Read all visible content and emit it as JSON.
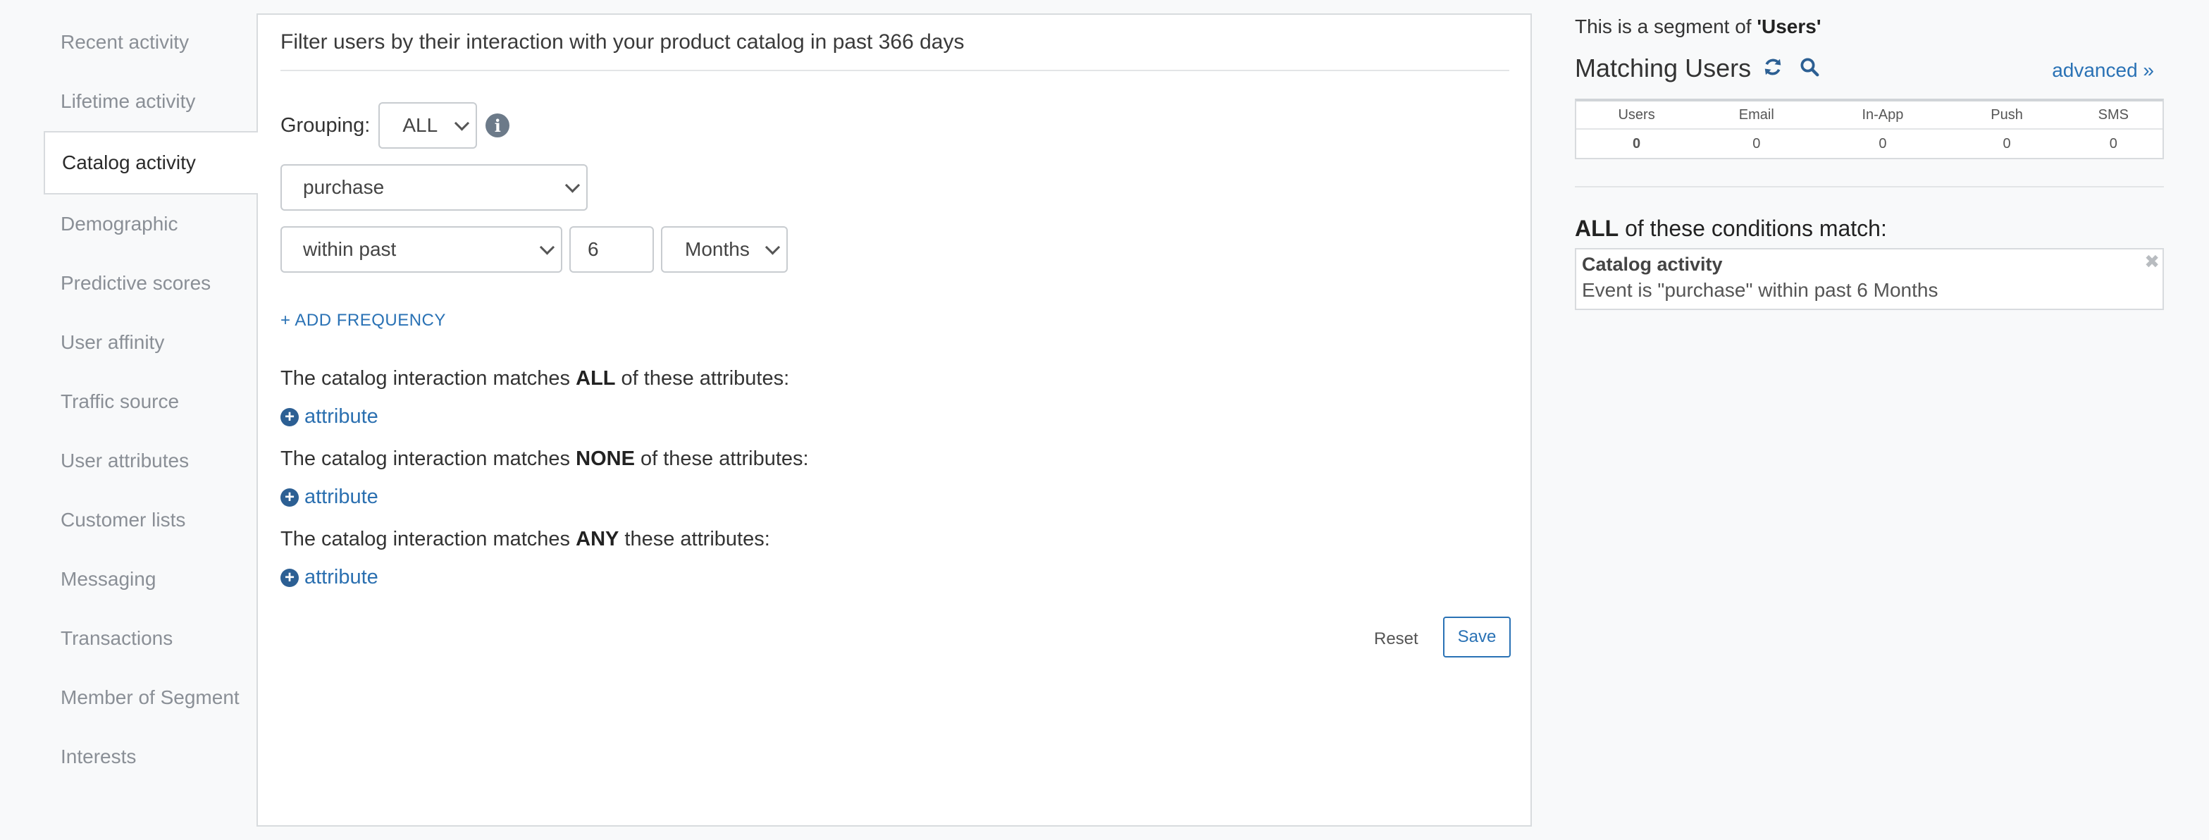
{
  "sidebar": {
    "items": [
      {
        "label": "Recent activity"
      },
      {
        "label": "Lifetime activity"
      },
      {
        "label": "Catalog activity",
        "active": true
      },
      {
        "label": "Demographic"
      },
      {
        "label": "Predictive scores"
      },
      {
        "label": "User affinity"
      },
      {
        "label": "Traffic source"
      },
      {
        "label": "User attributes"
      },
      {
        "label": "Customer lists"
      },
      {
        "label": "Messaging"
      },
      {
        "label": "Transactions"
      },
      {
        "label": "Member of Segment"
      },
      {
        "label": "Interests"
      }
    ]
  },
  "main": {
    "title": "Filter users by their interaction with your product catalog in past 366 days",
    "grouping_label": "Grouping:",
    "grouping_value": "ALL",
    "event_value": "purchase",
    "time_value": "within past",
    "number_value": "6",
    "unit_value": "Months",
    "add_frequency": "+ ADD FREQUENCY",
    "all_prefix": "The catalog interaction matches ",
    "all_bold": "ALL",
    "all_suffix": " of these attributes:",
    "none_prefix": "The catalog interaction matches ",
    "none_bold": "NONE",
    "none_suffix": " of these attributes:",
    "any_prefix": "The catalog interaction matches ",
    "any_bold": "ANY",
    "any_suffix": " these attributes:",
    "attribute_label": "attribute",
    "reset_label": "Reset",
    "save_label": "Save"
  },
  "right": {
    "segment_prefix": "This is a segment of ",
    "segment_name": "'Users'",
    "matching_title": "Matching Users",
    "advanced_label": "advanced »",
    "stats_headers": [
      "Users",
      "Email",
      "In-App",
      "Push",
      "SMS"
    ],
    "stats_values": [
      "0",
      "0",
      "0",
      "0",
      "0"
    ],
    "conditions_bold": "ALL",
    "conditions_rest": " of these conditions match:",
    "condition": {
      "name": "Catalog activity",
      "description": "Event is \"purchase\" within past 6 Months"
    }
  },
  "icons": {
    "info": "info-icon",
    "refresh": "refresh-icon",
    "search": "search-icon",
    "plus": "plus-circle-icon",
    "close": "close-icon"
  },
  "colors": {
    "accent": "#2a72b5",
    "background": "#f8f9fa"
  }
}
